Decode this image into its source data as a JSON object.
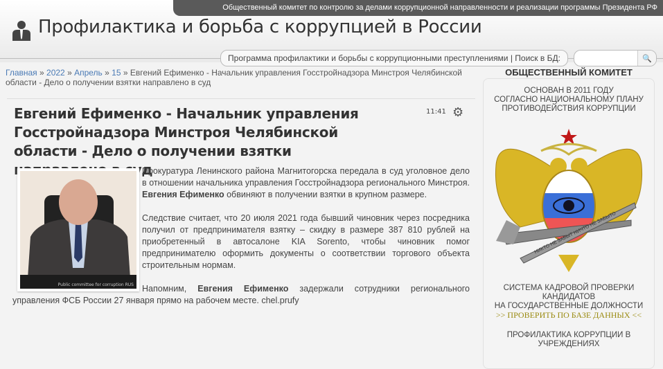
{
  "topbar": "Общественный комитет по контролю за делами коррупционной направленности и реализации программы Президента РФ",
  "site_title": "Профилактика и борьба с коррупцией в России",
  "nav": "Программа профилактики и борьбы с коррупционными преступлениями | Поиск в БД:",
  "search": {
    "placeholder": "",
    "button": "🔍"
  },
  "breadcrumb": {
    "items": [
      "Главная",
      "2022",
      "Апрель",
      "15"
    ],
    "sep": " » ",
    "current": "Евгений Ефименко - Начальник управления Госстройнадзора Минстроя Челябинской области - Дело о получении взятки направлено в суд"
  },
  "article": {
    "title": "Евгений Ефименко - Начальник управления Госстройнадзора Минстроя Челябинской области - Дело о получении взятки направлено в суд",
    "time": "11:41",
    "photo_caption": "Public committee for corruption RUS",
    "p1a": "Прокуратура Ленинского района Магнитогорска передала в суд уголовное дело в отношении начальника управления Госстройнадзора регионального Минстроя. ",
    "p1b": "Евгения Ефименко",
    "p1c": " обвиняют в получении взятки в крупном размере.",
    "p2": "Следствие считает, что 20 июля 2021 года бывший чиновник через посредника получил от предпринимателя взятку – скидку в размере 387 810 рублей на приобретенный в автосалоне KIA Sorento, чтобы чиновник помог предпринимателю оформить документы о соответствии торгового объекта строительным нормам.",
    "p3a": "Напомним, ",
    "p3b": "Евгения Ефименко",
    "p3c": " задержали сотрудники регионального управления ФСБ России 27 января прямо на рабочем месте.  chel.prufy"
  },
  "sidebar": {
    "heading": "ОБЩЕСТВЕННЫЙ КОМИТЕТ",
    "founded": [
      "ОСНОВАН В 2011 ГОДУ",
      "СОГЛАСНО НАЦИОНАЛЬНОМУ ПЛАНУ",
      "ПРОТИВОДЕЙСТВИЯ КОРРУПЦИИ"
    ],
    "emblem_motto": "НИКТО НЕ ЗАБЫТ НИЧТО НЕ ЗАБЫТО",
    "system": [
      "СИСТЕМА КАДРОВОЙ ПРОВЕРКИ",
      "КАНДИДАТОВ",
      "НА ГОСУДАРСТВЕННЫЕ ДОЛЖНОСТИ"
    ],
    "check_link": ">> ПРОВЕРИТЬ ПО БАЗЕ ДАННЫХ <<",
    "prevention": [
      "ПРОФИЛАКТИКА КОРРУПЦИИ В",
      "УЧРЕЖДЕНИЯХ"
    ]
  }
}
